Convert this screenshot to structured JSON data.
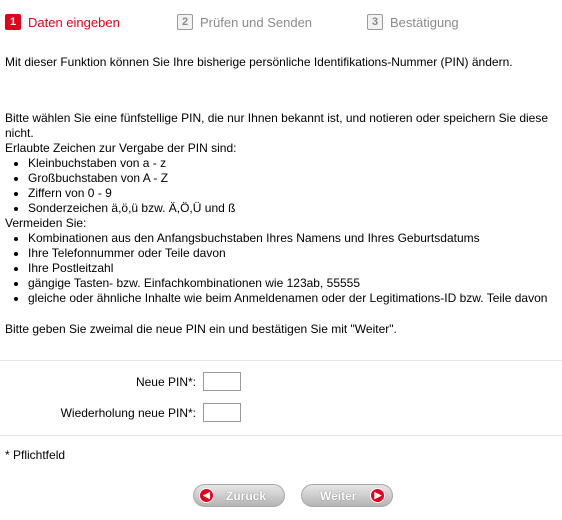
{
  "steps": [
    {
      "number": "1",
      "label": "Daten eingeben"
    },
    {
      "number": "2",
      "label": "Prüfen und Senden"
    },
    {
      "number": "3",
      "label": "Bestätigung"
    }
  ],
  "intro": "Mit dieser Funktion können Sie Ihre bisherige persönliche Identifikations-Nummer (PIN) ändern.",
  "choose_hint": "Bitte wählen Sie eine fünfstellige PIN, die nur Ihnen bekannt ist, und notieren oder speichern Sie diese nicht.",
  "allowed_heading": "Erlaubte Zeichen zur Vergabe der PIN sind:",
  "allowed_items": [
    "Kleinbuchstaben von a - z",
    "Großbuchstaben von A - Z",
    "Ziffern von 0 - 9",
    "Sonderzeichen ä,ö,ü bzw. Ä,Ö,Ü und ß"
  ],
  "avoid_heading": "Vermeiden Sie:",
  "avoid_items": [
    "Kombinationen aus den Anfangsbuchstaben Ihres Namens und Ihres Geburtsdatums",
    "Ihre Telefonnummer oder Teile davon",
    "Ihre Postleitzahl",
    "gängige Tasten- bzw. Einfachkombinationen wie 123ab, 55555",
    "gleiche oder ähnliche Inhalte wie beim Anmeldenamen oder der Legitimations-ID bzw. Teile davon"
  ],
  "confirm_hint": "Bitte geben Sie zweimal die neue PIN ein und bestätigen Sie mit \"Weiter\".",
  "form": {
    "new_pin_label": "Neue PIN*:",
    "new_pin_value": "",
    "repeat_pin_label": "Wiederholung neue PIN*:",
    "repeat_pin_value": ""
  },
  "required_note": "* Pflichtfeld",
  "buttons": {
    "back": "Zurück",
    "next": "Weiter"
  },
  "colors": {
    "accent": "#e2001a",
    "inactive": "#8a8a8a"
  }
}
